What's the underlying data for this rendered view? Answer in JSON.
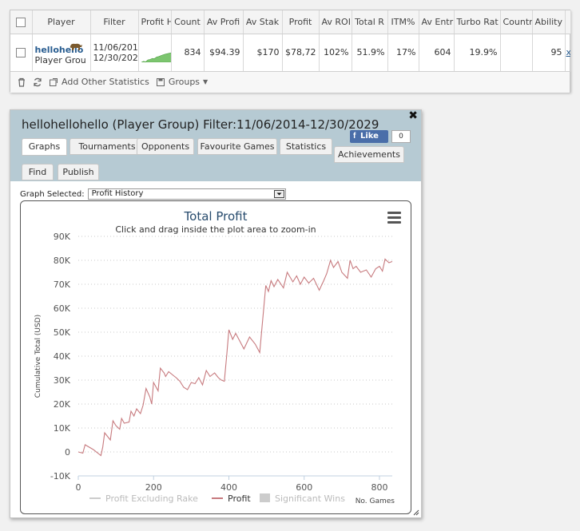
{
  "stats": {
    "headers": [
      "Player",
      "Filter",
      "Profit H",
      "Count",
      "Av Profi",
      "Av Stak",
      "Profit",
      "Av ROI",
      "Total R",
      "ITM%",
      "Av Entr",
      "Turbo Rat",
      "Countr",
      "Ability"
    ],
    "row": {
      "player_name": "hellohello",
      "player_group": "Player Grou",
      "filter_line1": "11/06/201",
      "filter_line2": "12/30/202",
      "count": "834",
      "av_profit": "$94.39",
      "av_stake": "$170",
      "profit": "$78,72",
      "av_roi": "102%",
      "total_roi": "51.9%",
      "itm": "17%",
      "av_entrants": "604",
      "turbo_ratio": "19.9%",
      "country": "",
      "ability": "95",
      "remove": "x"
    },
    "footer": {
      "add_stats": "Add Other Statistics",
      "groups": "Groups"
    },
    "sparkline": [
      0,
      0.1,
      0.05,
      0.25,
      0.3,
      0.4,
      0.38,
      0.55,
      0.6,
      0.7,
      0.78,
      0.85,
      0.9,
      0.95,
      1.0
    ]
  },
  "dialog": {
    "title": "hellohellohello (Player Group) Filter:11/06/2014-12/30/2029",
    "fb_like": "Like",
    "fb_count": "0",
    "tabs": [
      "Graphs",
      "Tournaments",
      "Opponents",
      "Favourite Games",
      "Statistics",
      "Achievements",
      "Find",
      "Publish"
    ],
    "graph_selected_label": "Graph Selected:",
    "graph_selected_value": "Profit History"
  },
  "chart_data": {
    "type": "line",
    "title": "Total Profit",
    "subtitle": "Click and drag inside the plot area to zoom-in",
    "xlabel": "No. Games",
    "ylabel": "Cumulative Total (USD)",
    "xlim": [
      0,
      834
    ],
    "ylim": [
      -10000,
      90000
    ],
    "xticks": [
      0,
      200,
      400,
      600,
      800
    ],
    "yticks": [
      -10000,
      0,
      10000,
      20000,
      30000,
      40000,
      50000,
      60000,
      70000,
      80000,
      90000
    ],
    "ytick_labels": [
      "-10K",
      "0",
      "10K",
      "20K",
      "30K",
      "40K",
      "50K",
      "60K",
      "70K",
      "80K",
      "90K"
    ],
    "legend": [
      "Profit Excluding Rake",
      "Profit",
      "Significant Wins"
    ],
    "grid": "horizontal-dotted",
    "series": [
      {
        "name": "Profit",
        "color": "#c77a7e",
        "x": [
          0,
          12,
          18,
          40,
          60,
          65,
          70,
          85,
          92,
          100,
          110,
          115,
          122,
          135,
          140,
          148,
          155,
          165,
          172,
          180,
          190,
          195,
          200,
          212,
          218,
          228,
          232,
          240,
          252,
          260,
          270,
          280,
          290,
          300,
          310,
          320,
          330,
          340,
          350,
          362,
          372,
          380,
          388,
          395,
          400,
          410,
          418,
          430,
          440,
          455,
          470,
          482,
          498,
          505,
          512,
          520,
          530,
          545,
          555,
          570,
          580,
          590,
          600,
          612,
          625,
          640,
          652,
          660,
          670,
          678,
          690,
          700,
          715,
          722,
          730,
          738,
          750,
          765,
          778,
          790,
          800,
          808,
          815,
          825,
          834
        ],
        "y": [
          0,
          -500,
          3000,
          1000,
          -1500,
          2000,
          8000,
          5000,
          13000,
          11000,
          9500,
          14000,
          12000,
          12500,
          17000,
          15000,
          18000,
          16000,
          19500,
          26500,
          23000,
          20000,
          29000,
          25500,
          35000,
          33000,
          31500,
          33500,
          32000,
          31000,
          29500,
          27000,
          26000,
          29000,
          28500,
          31000,
          28000,
          34000,
          31500,
          33000,
          31000,
          30000,
          29500,
          41500,
          51000,
          47000,
          49500,
          46000,
          43000,
          48000,
          45000,
          41500,
          69500,
          67000,
          71500,
          69000,
          72000,
          68500,
          75000,
          71000,
          73500,
          70000,
          73000,
          70500,
          72500,
          67500,
          71500,
          74500,
          80000,
          77000,
          79500,
          75000,
          72500,
          80000,
          76500,
          77500,
          75000,
          76000,
          73000,
          76500,
          77500,
          75500,
          80500,
          79000,
          79500
        ]
      }
    ]
  }
}
